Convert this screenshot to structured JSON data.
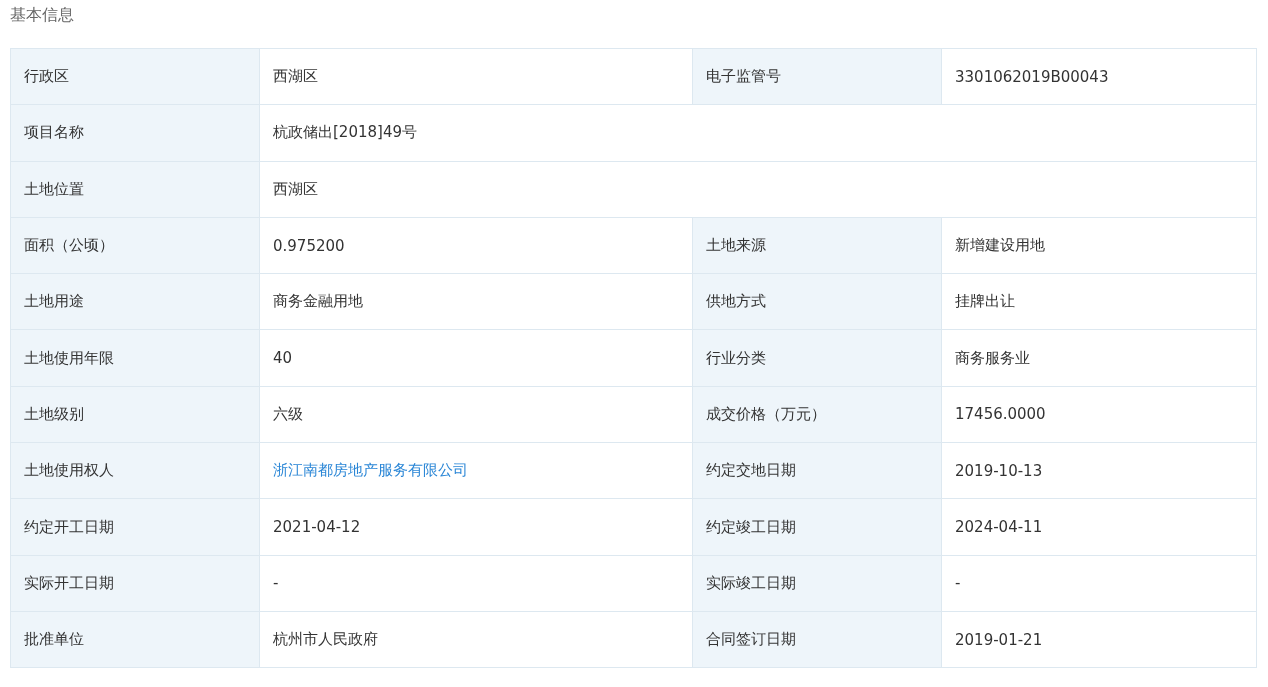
{
  "title": "基本信息",
  "rows": [
    {
      "fields": [
        {
          "label": "行政区",
          "value": "西湖区",
          "kind": "text"
        },
        {
          "label": "电子监管号",
          "value": "3301062019B00043",
          "kind": "text"
        }
      ]
    },
    {
      "fields": [
        {
          "label": "项目名称",
          "value": "杭政储出[2018]49号",
          "kind": "text"
        }
      ]
    },
    {
      "fields": [
        {
          "label": "土地位置",
          "value": "西湖区",
          "kind": "text"
        }
      ]
    },
    {
      "fields": [
        {
          "label": "面积（公顷）",
          "value": "0.975200",
          "kind": "text"
        },
        {
          "label": "土地来源",
          "value": "新增建设用地",
          "kind": "text"
        }
      ]
    },
    {
      "fields": [
        {
          "label": "土地用途",
          "value": "商务金融用地",
          "kind": "text"
        },
        {
          "label": "供地方式",
          "value": "挂牌出让",
          "kind": "text"
        }
      ]
    },
    {
      "fields": [
        {
          "label": "土地使用年限",
          "value": "40",
          "kind": "text"
        },
        {
          "label": "行业分类",
          "value": "商务服务业",
          "kind": "text"
        }
      ]
    },
    {
      "fields": [
        {
          "label": "土地级别",
          "value": "六级",
          "kind": "text"
        },
        {
          "label": "成交价格（万元）",
          "value": "17456.0000",
          "kind": "text"
        }
      ]
    },
    {
      "fields": [
        {
          "label": "土地使用权人",
          "value": "浙江南都房地产服务有限公司",
          "kind": "link"
        },
        {
          "label": "约定交地日期",
          "value": "2019-10-13",
          "kind": "text"
        }
      ]
    },
    {
      "fields": [
        {
          "label": "约定开工日期",
          "value": "2021-04-12",
          "kind": "text"
        },
        {
          "label": "约定竣工日期",
          "value": "2024-04-11",
          "kind": "text"
        }
      ]
    },
    {
      "fields": [
        {
          "label": "实际开工日期",
          "value": "-",
          "kind": "text"
        },
        {
          "label": "实际竣工日期",
          "value": "-",
          "kind": "text"
        }
      ]
    },
    {
      "fields": [
        {
          "label": "批准单位",
          "value": "杭州市人民政府",
          "kind": "text"
        },
        {
          "label": "合同签订日期",
          "value": "2019-01-21",
          "kind": "text"
        }
      ]
    }
  ]
}
